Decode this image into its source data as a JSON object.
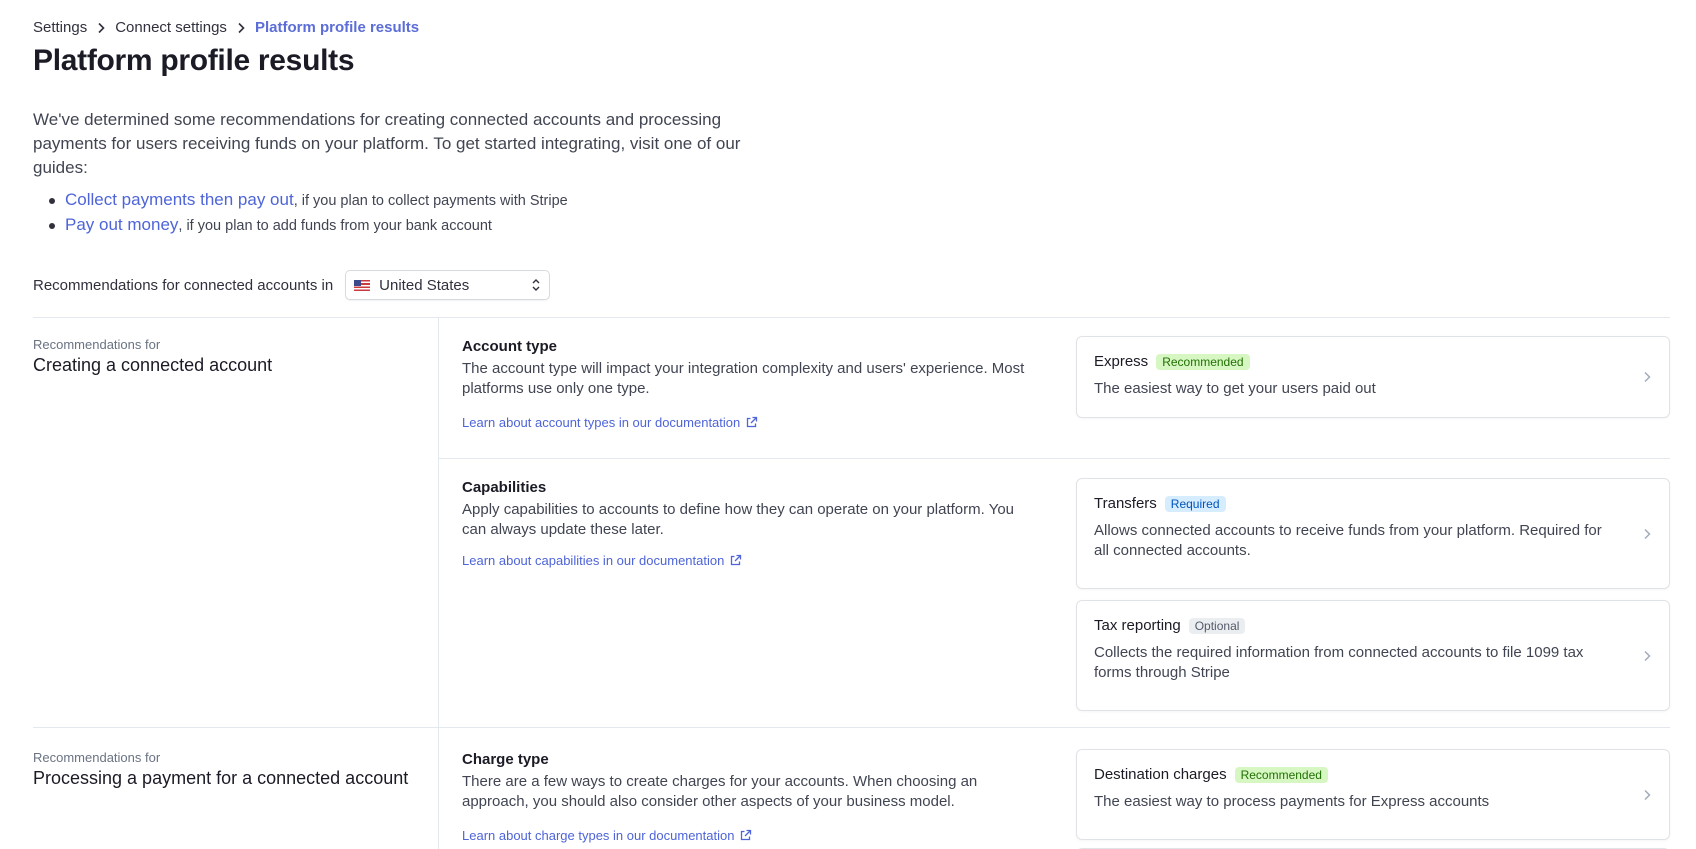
{
  "breadcrumb": {
    "items": [
      "Settings",
      "Connect settings"
    ],
    "current": "Platform profile results"
  },
  "page": {
    "title": "Platform profile results",
    "intro": "We've determined some recommendations for creating connected accounts and processing payments for users receiving funds on your platform. To get started integrating, visit one of our guides:",
    "guides": [
      {
        "link": "Collect payments then pay out",
        "suffix": ", if you plan to collect payments with Stripe"
      },
      {
        "link": "Pay out money",
        "suffix": ", if you plan to add funds from your bank account"
      }
    ]
  },
  "country": {
    "label": "Recommendations for connected accounts in",
    "selected": "United States",
    "flag_icon": "us-flag-icon"
  },
  "sections": [
    {
      "kicker": "Recommendations for",
      "heading": "Creating a connected account",
      "blocks": [
        {
          "title": "Account type",
          "description": "The account type will impact your integration complexity and users' experience. Most platforms use only one type.",
          "link": "Learn about account types in our documentation",
          "cards": [
            {
              "title": "Express",
              "badge": "Recommended",
              "description": "The easiest way to get your users paid out"
            }
          ]
        },
        {
          "title": "Capabilities",
          "description": "Apply capabilities to accounts to define how they can operate on your platform. You can always update these later.",
          "link": "Learn about capabilities in our documentation",
          "cards": [
            {
              "title": "Transfers",
              "badge": "Required",
              "description": "Allows connected accounts to receive funds from your platform. Required for all connected accounts."
            },
            {
              "title": "Tax reporting",
              "badge": "Optional",
              "description": "Collects the required information from connected accounts to file 1099 tax forms through Stripe"
            }
          ]
        }
      ]
    },
    {
      "kicker": "Recommendations for",
      "heading": "Processing a payment for a connected account",
      "blocks": [
        {
          "title": "Charge type",
          "description": "There are a few ways to create charges for your accounts. When choosing an approach, you should also consider other aspects of your business model.",
          "link": "Learn about charge types in our documentation",
          "cards": [
            {
              "title": "Destination charges",
              "badge": "Recommended",
              "description": "The easiest way to process payments for Express accounts"
            }
          ]
        }
      ]
    }
  ],
  "colors": {
    "accent": "#4e64d8",
    "recommended_bg": "#d7f7c2",
    "required_bg": "#d6ecff",
    "optional_bg": "#ebeef1"
  }
}
